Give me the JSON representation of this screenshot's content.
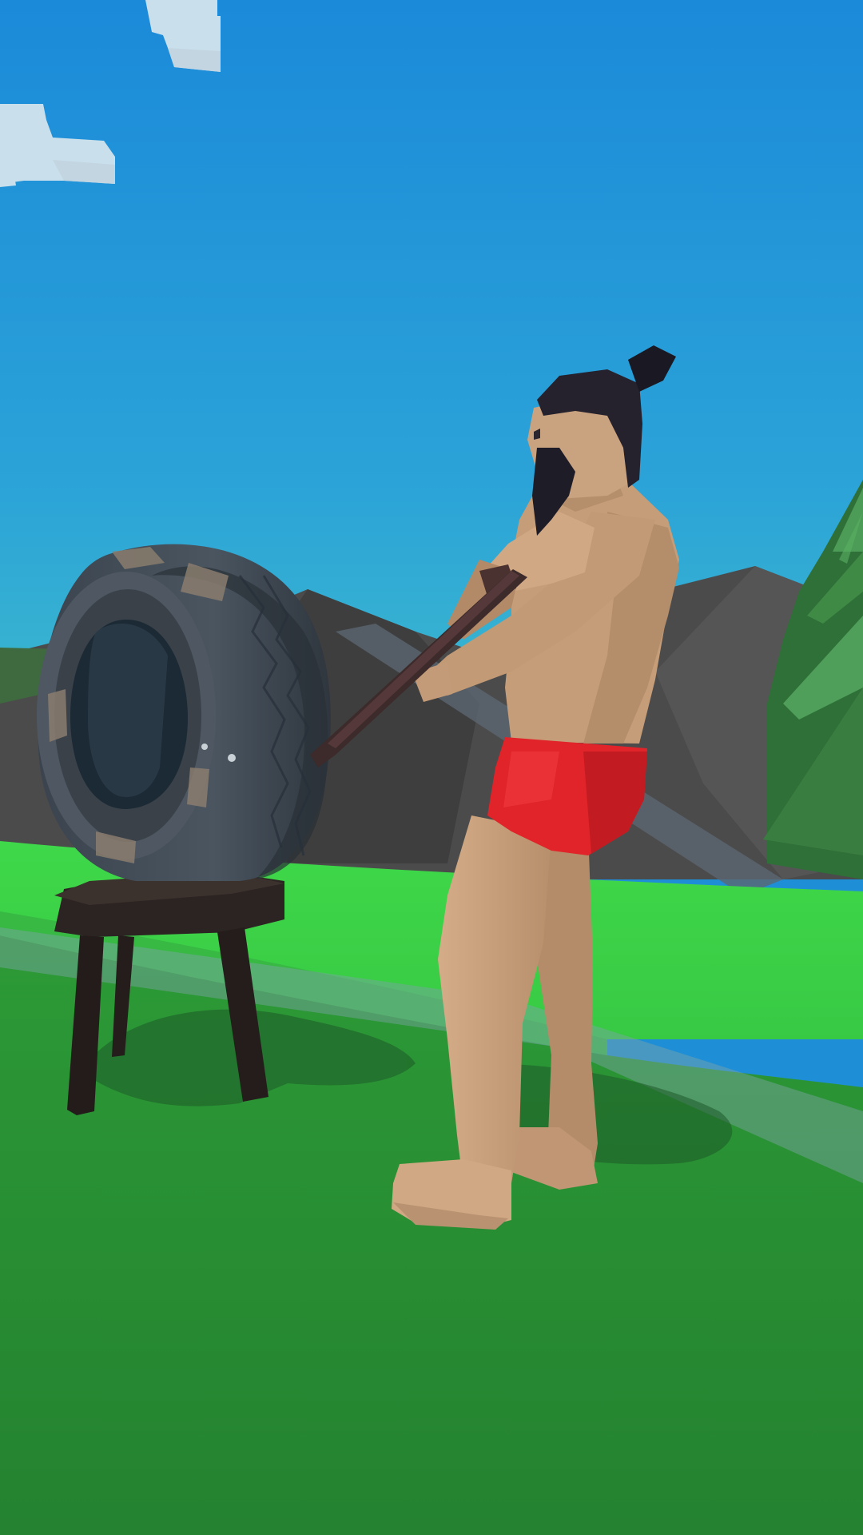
{
  "scene": {
    "type": "3d-game-view",
    "hud_text": [],
    "objects": {
      "sky": {
        "icon": "sky",
        "color": "#1f8fd8"
      },
      "clouds": {
        "icon": "voxel-cloud",
        "color": "#d7e6ef"
      },
      "mountains": {
        "icon": "low-poly-mountain",
        "color": "#4a4a4a"
      },
      "ground": {
        "icon": "grass-field",
        "colors": [
          "#41e04f",
          "#2f9b37",
          "#258030"
        ]
      },
      "trees": {
        "icon": "low-poly-pine-tree",
        "color": "#3f8a45"
      },
      "tire": {
        "icon": "tire-target",
        "color": "#3d4650"
      },
      "stool": {
        "icon": "wooden-stool",
        "color": "#2e2523"
      },
      "player": {
        "icon": "bearded-strongman",
        "skin_color": "#c9a27f",
        "shorts_color": "#e0252a",
        "hair_color": "#22202c"
      },
      "sledgehammer": {
        "icon": "sledgehammer",
        "color": "#3d2a2a"
      }
    }
  }
}
